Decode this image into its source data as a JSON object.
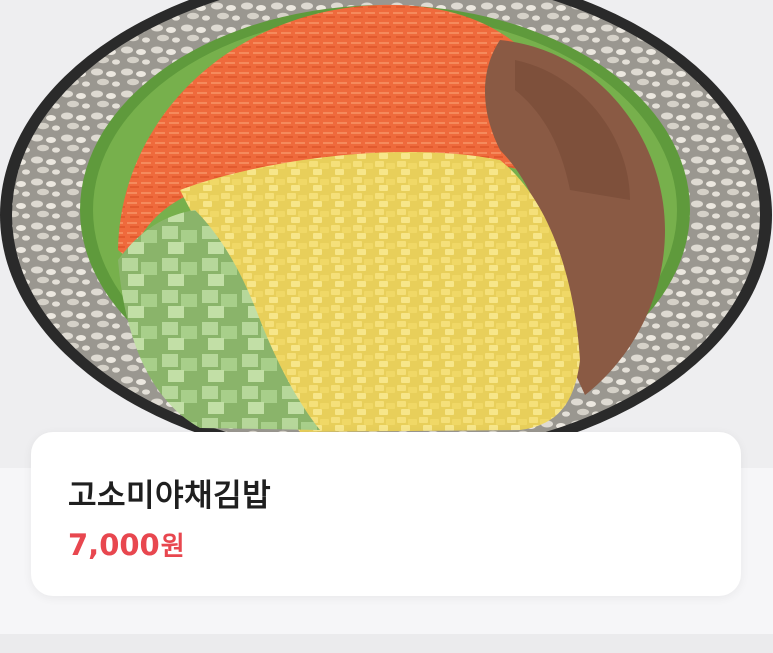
{
  "product": {
    "image_subject": "kimbap-cross-section",
    "name": "고소미야채김밥",
    "price_value": "7,000",
    "price_unit": "원"
  },
  "colors": {
    "price": "#e8474f",
    "name": "#1f1f1f",
    "card_background": "#ffffff",
    "page_background": "#f6f6f8"
  }
}
